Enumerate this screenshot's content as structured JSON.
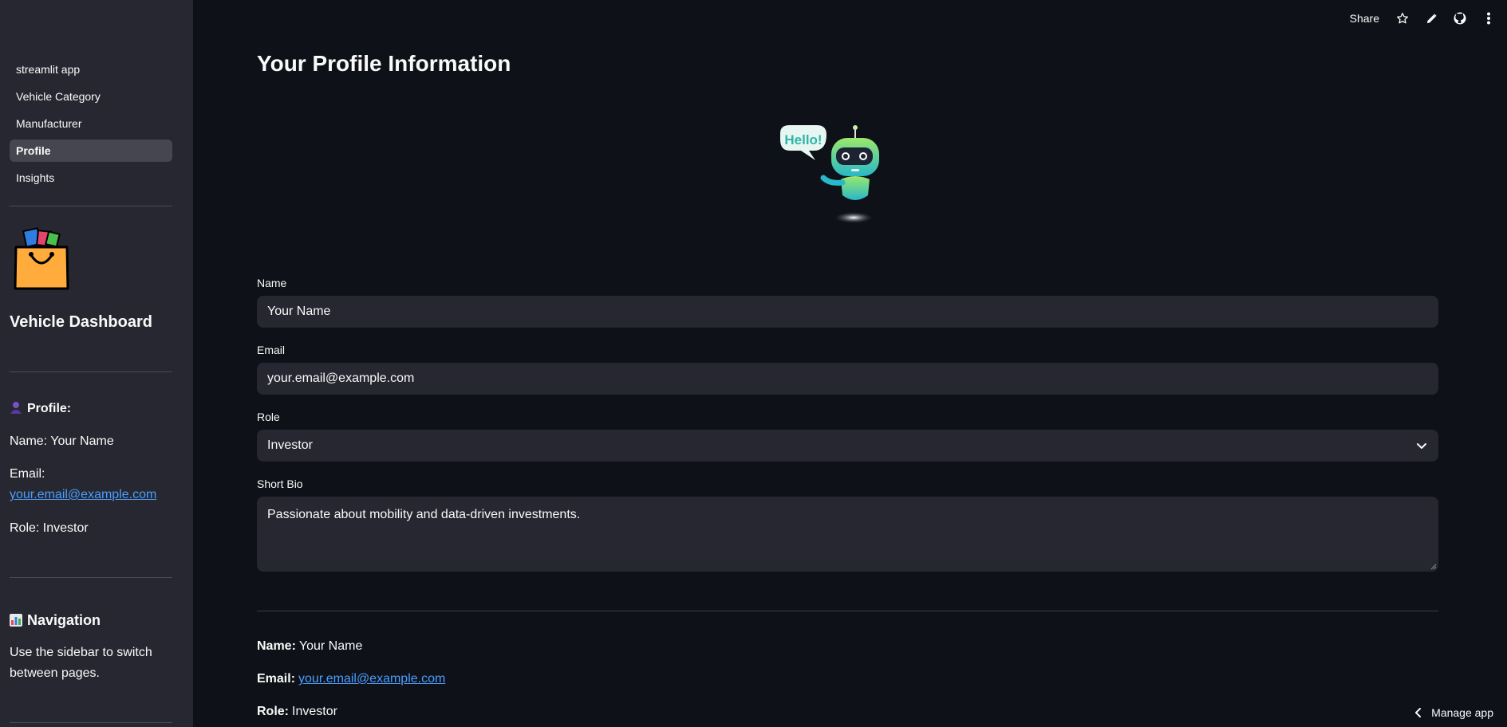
{
  "sidebar": {
    "nav_items": [
      {
        "label": "streamlit app"
      },
      {
        "label": "Vehicle Category"
      },
      {
        "label": "Manufacturer"
      },
      {
        "label": "Profile",
        "active": true
      },
      {
        "label": "Insights"
      }
    ],
    "title": "Vehicle Dashboard",
    "profile_heading": "Profile:",
    "name_line": "Name: Your Name",
    "email_label": "Email:",
    "email_link": "your.email@example.com",
    "role_line": "Role: Investor",
    "nav_heading": "Navigation",
    "nav_help_line1": "Use the sidebar to switch",
    "nav_help_line2": "between pages."
  },
  "header": {
    "share_label": "Share",
    "icons": [
      "star-icon",
      "edit-icon",
      "github-icon",
      "more-icon"
    ]
  },
  "main": {
    "title": "Your Profile Information",
    "illustration_text": "Hello!",
    "name_label": "Name",
    "name_value": "Your Name",
    "email_label": "Email",
    "email_value": "your.email@example.com",
    "role_label": "Role",
    "role_value": "Investor",
    "bio_label": "Short Bio",
    "bio_value": "Passionate about mobility and data-driven investments.",
    "summary_name_label": "Name:",
    "summary_name_value": "Your Name",
    "summary_email_label": "Email:",
    "summary_email_value": "your.email@example.com",
    "summary_role_label": "Role:",
    "summary_role_value": "Investor"
  },
  "footer": {
    "manage_label": "Manage app"
  },
  "colors": {
    "background": "#0e1117",
    "sidebar": "#262730",
    "link": "#4a9eff"
  }
}
